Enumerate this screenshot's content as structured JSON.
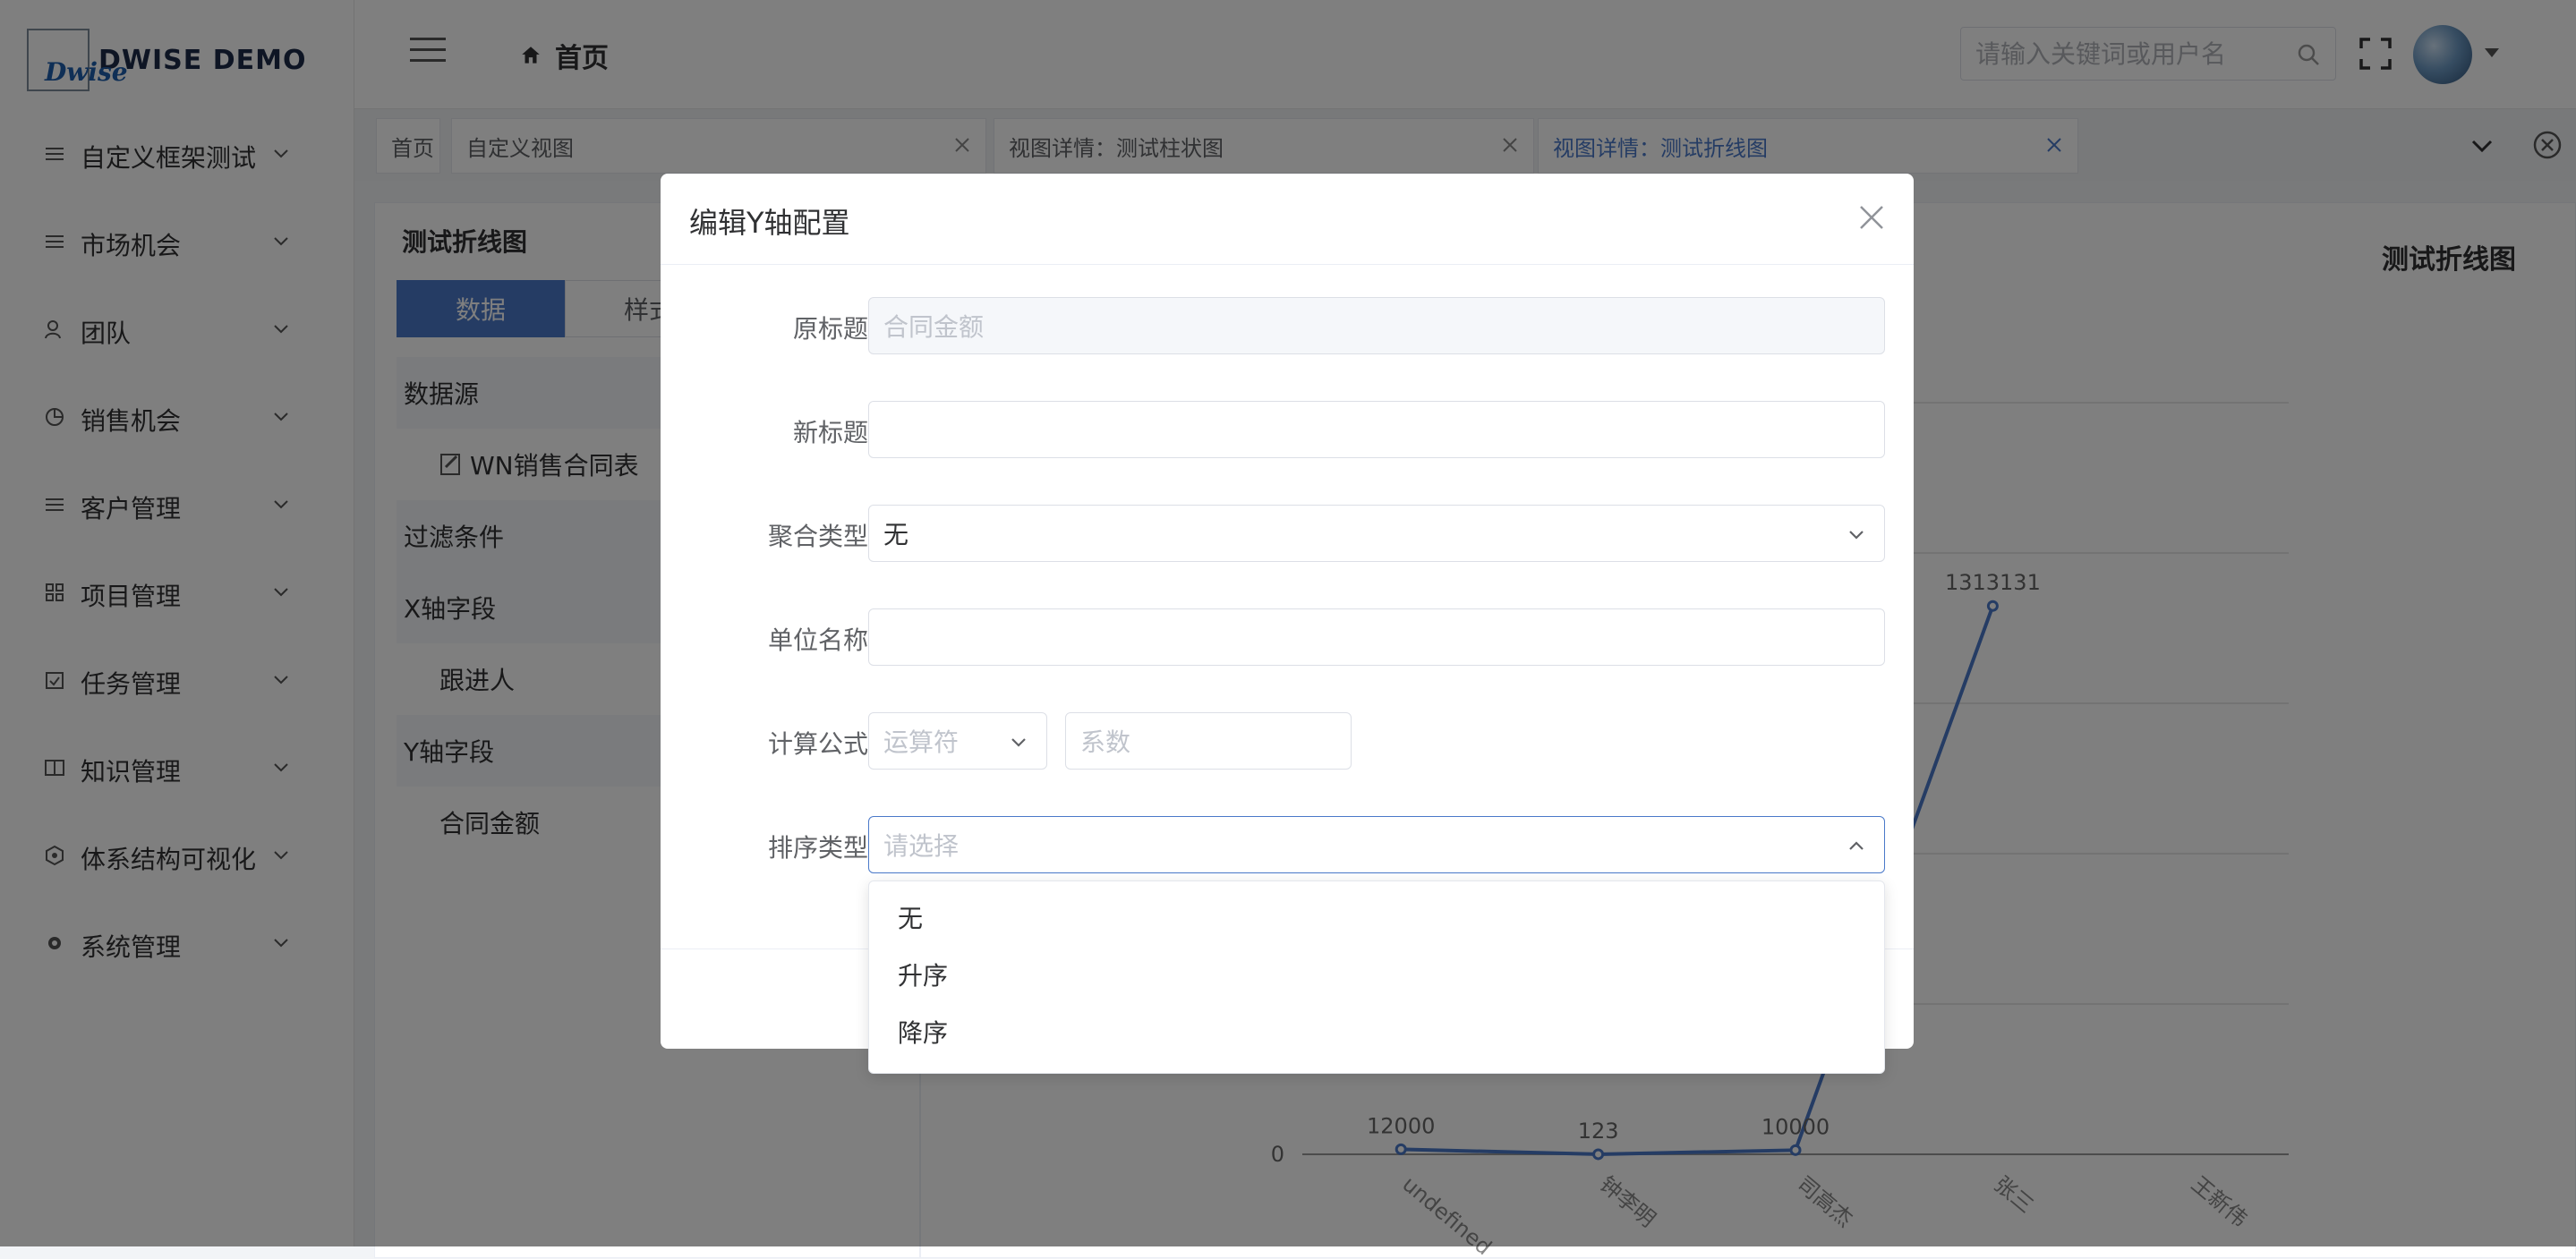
{
  "brand": {
    "logo_text": "Dwise",
    "name": "DWISE DEMO"
  },
  "sidebar": {
    "items": [
      {
        "label": "自定义框架测试",
        "icon": "list-icon"
      },
      {
        "label": "市场机会",
        "icon": "list-icon"
      },
      {
        "label": "团队",
        "icon": "user-icon"
      },
      {
        "label": "销售机会",
        "icon": "pie-icon"
      },
      {
        "label": "客户管理",
        "icon": "list-icon"
      },
      {
        "label": "项目管理",
        "icon": "grid-icon"
      },
      {
        "label": "任务管理",
        "icon": "task-icon"
      },
      {
        "label": "知识管理",
        "icon": "book-icon"
      },
      {
        "label": "体系结构可视化",
        "icon": "hexagon-icon"
      },
      {
        "label": "系统管理",
        "icon": "gear-icon"
      }
    ]
  },
  "header": {
    "breadcrumb": "首页",
    "search_placeholder": "请输入关键词或用户名"
  },
  "tabs": [
    {
      "label": "首页",
      "closable": false,
      "active": false
    },
    {
      "label": "自定义视图",
      "closable": true,
      "active": false
    },
    {
      "label": "视图详情：测试柱状图",
      "closable": true,
      "active": false
    },
    {
      "label": "视图详情：测试折线图",
      "closable": true,
      "active": true
    }
  ],
  "left_panel": {
    "title": "测试折线图",
    "segments": [
      "数据",
      "样式"
    ],
    "rows": [
      {
        "label": "数据源",
        "type": "sec"
      },
      {
        "label": "WN销售合同表",
        "type": "sub"
      },
      {
        "label": "过滤条件",
        "type": "sec"
      },
      {
        "label": "X轴字段",
        "type": "sec"
      },
      {
        "label": "跟进人",
        "type": "sub"
      },
      {
        "label": "Y轴字段",
        "type": "sec"
      },
      {
        "label": "合同金额",
        "type": "sub"
      }
    ]
  },
  "chart_data": {
    "type": "line",
    "title": "测试折线图",
    "categories": [
      "undefined",
      "钟李明",
      "司高杰",
      "张三",
      "王新伟"
    ],
    "values": [
      12000,
      123,
      10000,
      1313131,
      null
    ],
    "y_tick_labels": [
      "0"
    ],
    "color": "#4a79c9"
  },
  "dialog": {
    "title": "编辑Y轴配置",
    "fields": {
      "original_title": {
        "label": "原标题",
        "placeholder": "合同金额"
      },
      "new_title": {
        "label": "新标题",
        "value": ""
      },
      "agg_type": {
        "label": "聚合类型",
        "value": "无"
      },
      "unit_name": {
        "label": "单位名称",
        "value": ""
      },
      "formula": {
        "label": "计算公式",
        "operator_placeholder": "运算符",
        "coef_placeholder": "系数"
      },
      "sort_type": {
        "label": "排序类型",
        "placeholder": "请选择"
      }
    },
    "sort_options": [
      "无",
      "升序",
      "降序"
    ]
  },
  "colors": {
    "primary": "#4a79c9",
    "overlay": "rgba(0,0,0,0.5)"
  }
}
